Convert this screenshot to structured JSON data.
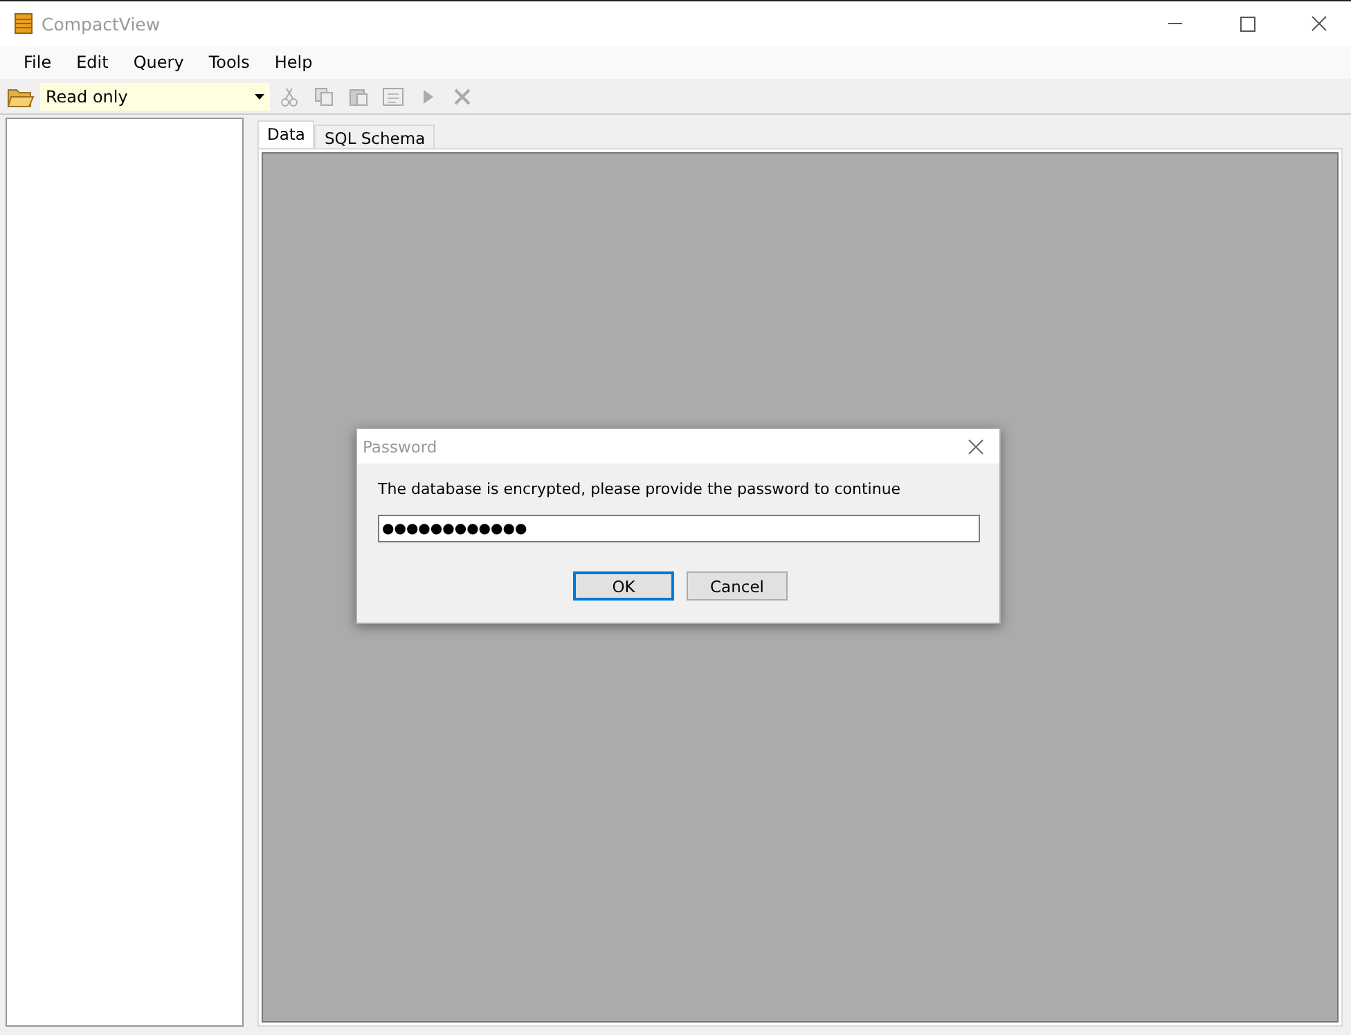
{
  "window": {
    "title": "CompactView"
  },
  "menu": [
    "File",
    "Edit",
    "Query",
    "Tools",
    "Help"
  ],
  "toolbar": {
    "mode": "Read only",
    "buttons": [
      {
        "kind": "cut",
        "disabled": true
      },
      {
        "kind": "copy",
        "disabled": true
      },
      {
        "kind": "paste",
        "disabled": true
      },
      {
        "kind": "sql",
        "disabled": true
      },
      {
        "kind": "run",
        "disabled": true
      },
      {
        "kind": "stop",
        "disabled": true
      }
    ]
  },
  "tabs": [
    {
      "label": "Data",
      "selected": true
    },
    {
      "label": "SQL Schema",
      "selected": false
    }
  ],
  "dialog": {
    "title": "Password",
    "message": "The database is encrypted, please provide the password to continue",
    "password": "●●●●●●●●●●●●",
    "buttons": [
      {
        "label": "OK",
        "default": true
      },
      {
        "label": "Cancel",
        "default": false
      }
    ]
  }
}
